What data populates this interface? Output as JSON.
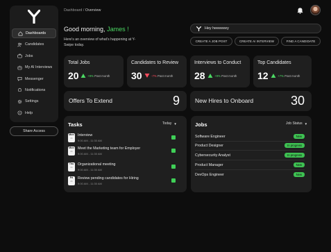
{
  "breadcrumb": {
    "root": "Dashboard",
    "separator": "/",
    "current": "Overview"
  },
  "greeting": {
    "prefix": "Good morning,",
    "name": "James !",
    "subtitle": "Here's an overview of what's happening at Y-Swipe today."
  },
  "sidebar": {
    "items": [
      {
        "label": "Dashboards",
        "icon": "home-icon",
        "active": true
      },
      {
        "label": "Candidates",
        "icon": "people-icon",
        "active": false
      },
      {
        "label": "Jobs",
        "icon": "briefcase-icon",
        "active": false
      },
      {
        "label": "My AI Interviews",
        "icon": "robot-icon",
        "active": false
      },
      {
        "label": "Messenger",
        "icon": "chat-icon",
        "active": false
      },
      {
        "label": "Notifications",
        "icon": "bell-icon",
        "active": false
      },
      {
        "label": "Settings",
        "icon": "gear-icon",
        "active": false
      },
      {
        "label": "Help",
        "icon": "help-icon",
        "active": false
      }
    ],
    "share_label": "Share Access"
  },
  "chat": {
    "value": "Hey heeeeeey"
  },
  "actions": {
    "create_job": "CREATE A JOB POST",
    "create_interview": "CREATE AI INTERVIEW",
    "find_candidate": "FIND A CANDIDATE"
  },
  "stats": [
    {
      "title": "Total Jobs",
      "value": "20",
      "change": "+9%",
      "suffix": "Past month",
      "trend": "up"
    },
    {
      "title": "Candidates to Review",
      "value": "30",
      "change": "-7%",
      "suffix": "Past month",
      "trend": "down"
    },
    {
      "title": "Interviews to Conduct",
      "value": "28",
      "change": "+9%",
      "suffix": "Past month",
      "trend": "up"
    },
    {
      "title": "Top Candidates",
      "value": "12",
      "change": "+7%",
      "suffix": "Past month",
      "trend": "up"
    }
  ],
  "summary": {
    "offers": {
      "title": "Offers To Extend",
      "value": "9"
    },
    "hires": {
      "title": "New Hires to Onboard",
      "value": "30"
    }
  },
  "tasks": {
    "title": "Tasks",
    "filter": "Today",
    "items": [
      {
        "day": "Mon",
        "title": "Interview",
        "time": "9:00 AM - 11:30 AM"
      },
      {
        "day": "Mon",
        "title": "Meet the Marketing team for Employer",
        "time": "9:00 AM - 11:30 AM"
      },
      {
        "day": "Thu",
        "title": "Organizational meeting",
        "time": "9:00 AM - 11:30 AM"
      },
      {
        "day": "Fri",
        "title": "Review pending candidates for Hiring",
        "time": "9:00 AM - 11:30 AM"
      }
    ]
  },
  "jobs": {
    "title": "Jobs",
    "filter": "Job Status",
    "items": [
      {
        "name": "Software Engineer",
        "status": "New"
      },
      {
        "name": "Product Designer",
        "status": "In progress"
      },
      {
        "name": "Cybersecurity Analyst",
        "status": "In progress"
      },
      {
        "name": "Product Manager",
        "status": "New"
      },
      {
        "name": "DevOps Engineer",
        "status": "New"
      }
    ]
  },
  "colors": {
    "accent": "#4cd964",
    "negative": "#ff4d5e",
    "card": "#1f1f1f",
    "background": "#0d0d0d"
  }
}
